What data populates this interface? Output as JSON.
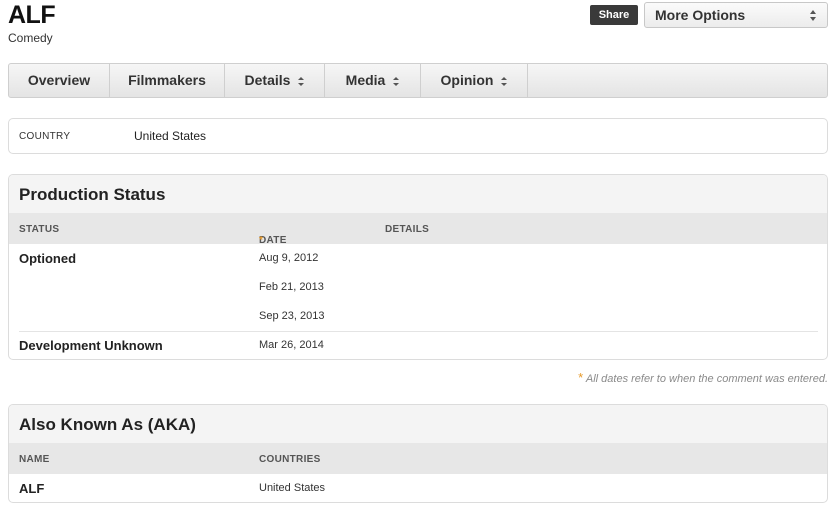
{
  "header": {
    "title": "ALF",
    "genre": "Comedy"
  },
  "actions": {
    "share_label": "Share",
    "more_options_label": "More Options"
  },
  "tabs": [
    {
      "label": "Overview",
      "dropdown": false
    },
    {
      "label": "Filmmakers",
      "dropdown": false
    },
    {
      "label": "Details",
      "dropdown": true
    },
    {
      "label": "Media",
      "dropdown": true
    },
    {
      "label": "Opinion",
      "dropdown": true
    }
  ],
  "country": {
    "label": "COUNTRY",
    "value": "United States"
  },
  "production": {
    "title": "Production Status",
    "columns": {
      "status": "STATUS",
      "date": "DATE",
      "date_marker": "*",
      "details": "DETAILS"
    },
    "rows": [
      {
        "status": "Optioned",
        "date": "Aug 9, 2012"
      },
      {
        "status": "",
        "date": "Feb 21, 2013"
      },
      {
        "status": "",
        "date": "Sep 23, 2013"
      },
      {
        "status": "Development Unknown",
        "date": "Mar 26, 2014"
      }
    ],
    "footnote_marker": "*",
    "footnote": "All dates refer to when the comment was entered."
  },
  "aka": {
    "title": "Also Known As (AKA)",
    "columns": {
      "name": "NAME",
      "countries": "COUNTRIES"
    },
    "rows": [
      {
        "name": "ALF",
        "countries": "United States"
      }
    ]
  },
  "colors": {
    "accent_star": "#e79a2a",
    "share_bg": "#3a3a3a",
    "header_bg": "#f4f4f4",
    "column_bg": "#e7e7e7"
  },
  "icons": {
    "dropdown": "up-down-arrows-icon"
  }
}
